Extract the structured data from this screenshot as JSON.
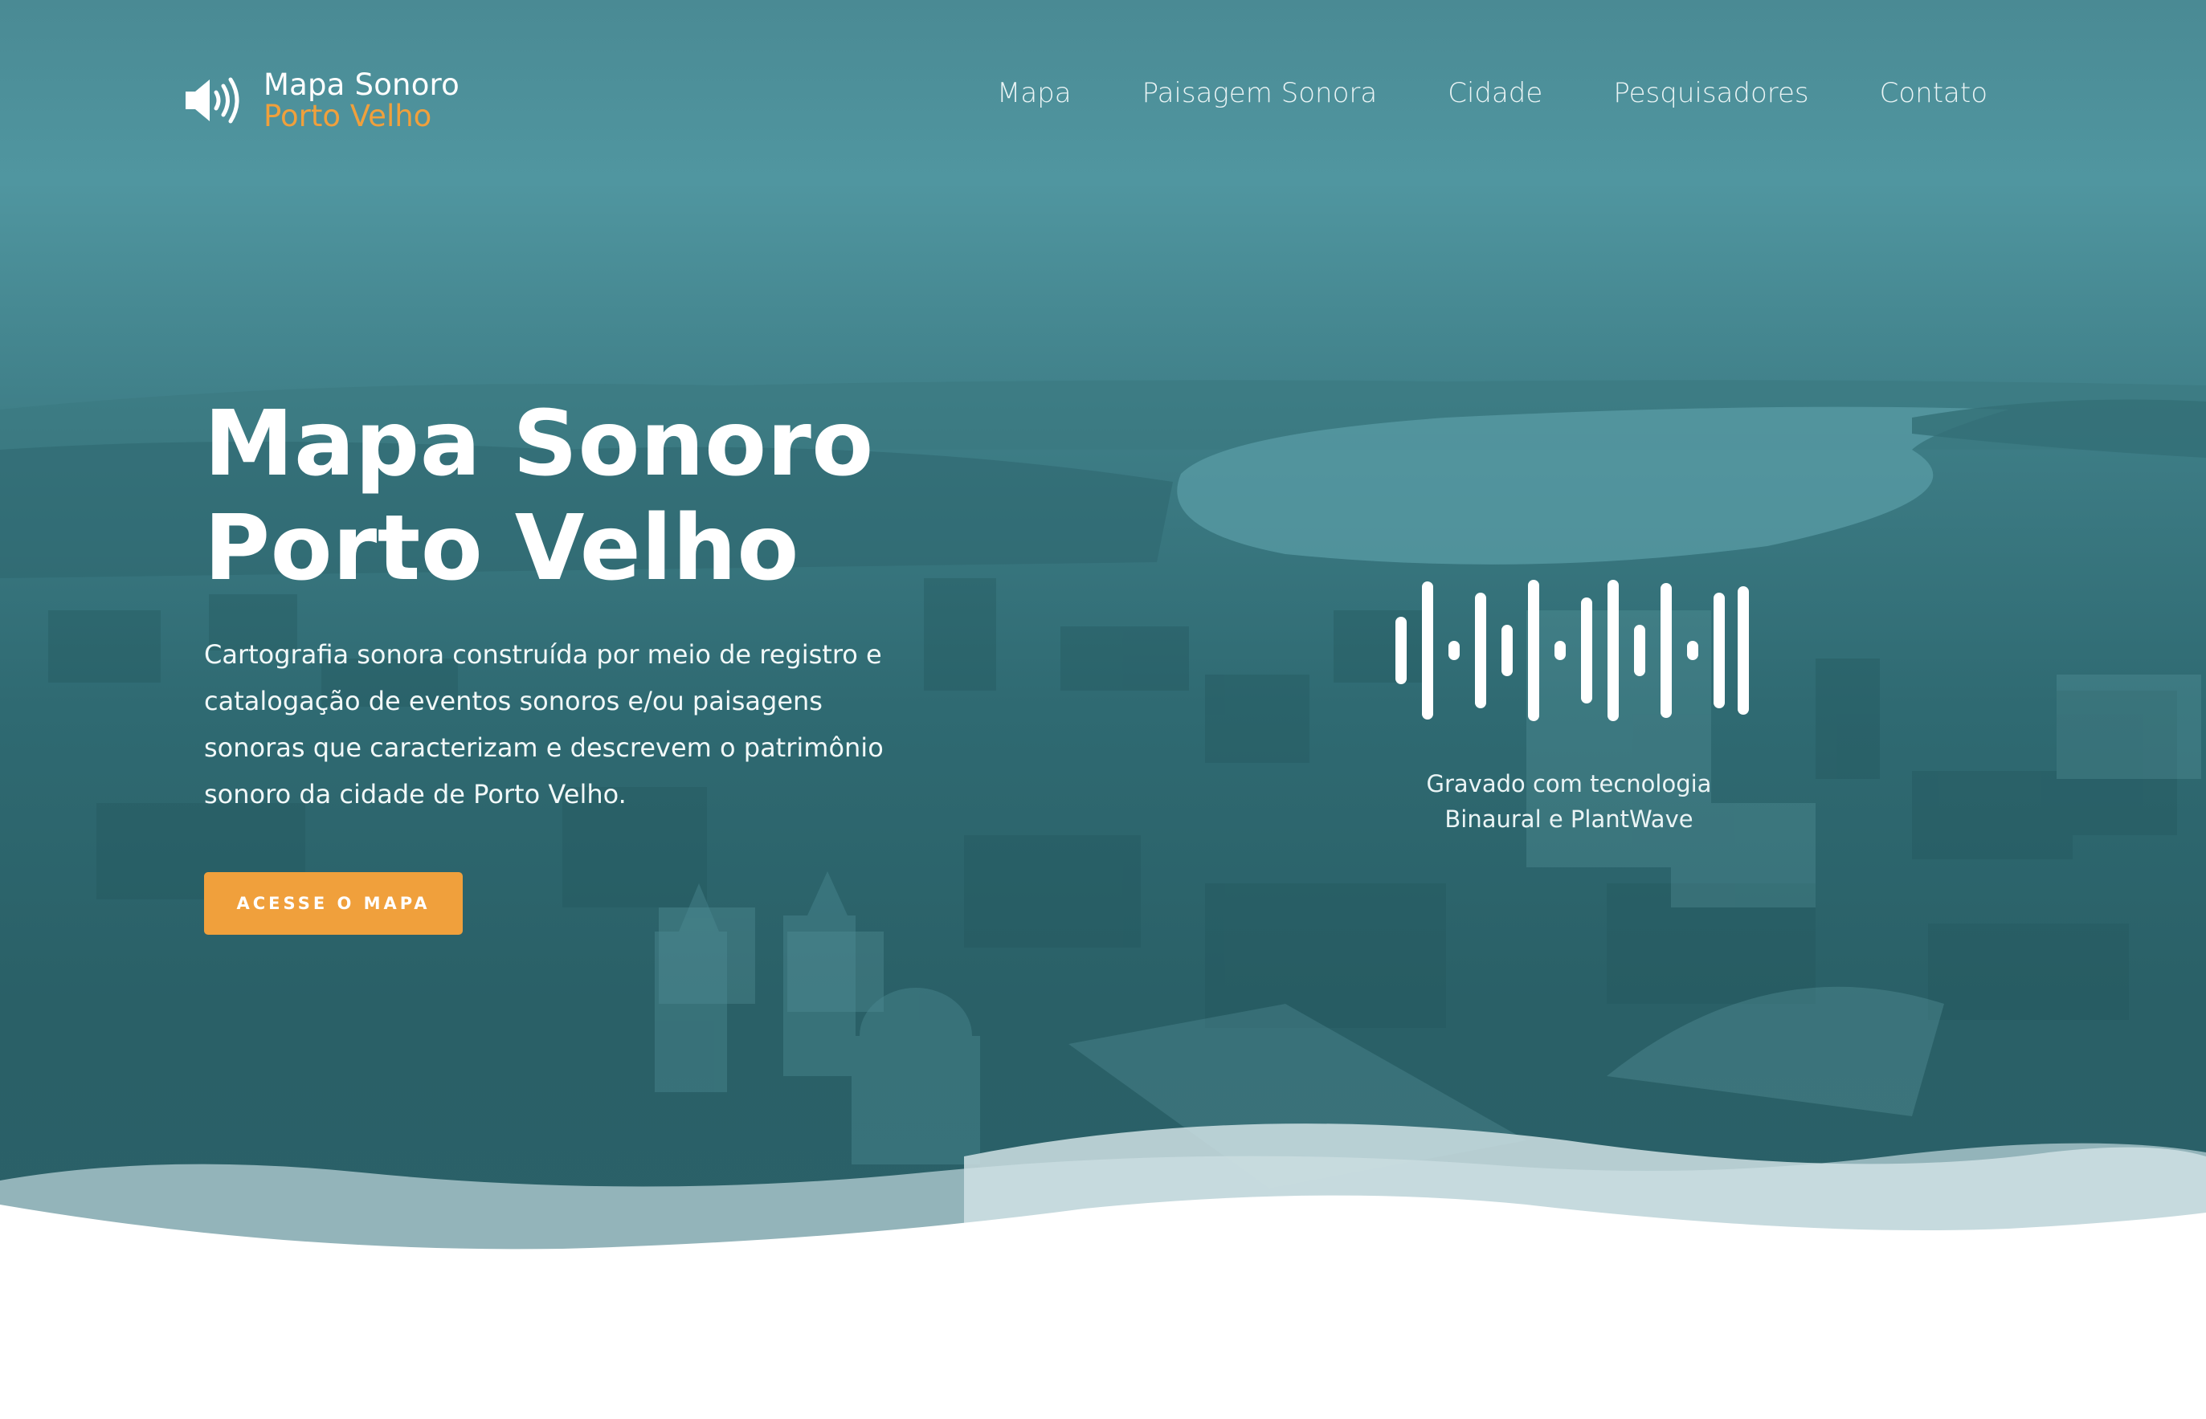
{
  "brand": {
    "line1": "Mapa Sonoro",
    "line2": "Porto Velho",
    "icon": "speaker-volume-icon",
    "accent_color": "#f0a03c"
  },
  "nav": {
    "items": [
      "Mapa",
      "Paisagem Sonora",
      "Cidade",
      "Pesquisadores",
      "Contato"
    ]
  },
  "hero": {
    "title_line1": "Mapa Sonoro",
    "title_line2": "Porto Velho",
    "description": "Cartografia sonora construída por meio de registro e catalogação de eventos sonoros e/ou paisagens sonoras que caracterizam e descrevem o patrimônio sonoro da cidade de Porto Velho.",
    "cta_label": "ACESSE O MAPA",
    "overlay_color": "#2f6a72"
  },
  "recording": {
    "icon": "sound-wave-icon",
    "line1": "Gravado com tecnologia",
    "line2": "Binaural e PlantWave"
  }
}
